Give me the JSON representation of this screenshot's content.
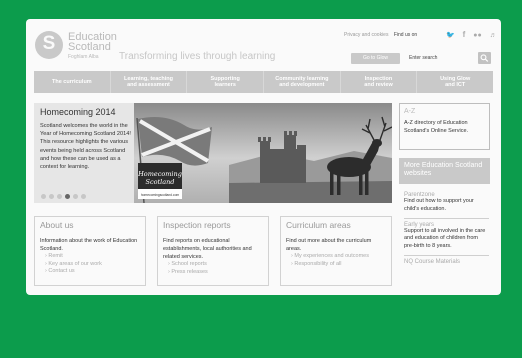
{
  "header": {
    "brand_line1": "Education",
    "brand_line2": "Scotland",
    "brand_gaelic": "Foghlam Alba",
    "logo_letter": "S",
    "tagline": "Transforming lives through learning",
    "top_links": [
      "Privacy and cookies",
      "Find us on"
    ],
    "social_icons": [
      "twitter-icon",
      "facebook-icon",
      "flickr-icon",
      "podcast-icon"
    ],
    "glow_label": "Go to Glow",
    "search_placeholder": "Enter search"
  },
  "nav": {
    "items": [
      {
        "label": "The curriculum"
      },
      {
        "label": "Learning, teaching\nand assessment"
      },
      {
        "label": "Supporting\nlearners"
      },
      {
        "label": "Community learning\nand development"
      },
      {
        "label": "Inspection\nand review"
      },
      {
        "label": "Using Glow\nand ICT"
      }
    ]
  },
  "feature": {
    "title": "Homecoming 2014",
    "text": "Scotland welcomes the world in the Year of Homecoming Scotland 2014! This resource highlights the various events being held across Scotland and how these can be used as a context for learning.",
    "sign_line1": "Homecoming",
    "sign_line2": "Scotland",
    "sign_url": "homecomingscotland.com",
    "slides": 6,
    "active_slide": 3
  },
  "sidebar": {
    "az_title": "A-Z",
    "az_desc": "A-Z directory of Education Scotland's Online Service.",
    "more_title": "More Education Scotland websites",
    "links": [
      {
        "title": "Parentzone",
        "desc": "Find out how to support your child's education."
      },
      {
        "title": "Early years",
        "desc": "Support to all involved in the care and education of children from pre-birth to 8 years."
      },
      {
        "title": "NQ Course Materials",
        "desc": ""
      }
    ]
  },
  "boxes": [
    {
      "title": "About us",
      "text": "Information about the work of Education Scotland.",
      "links": [
        "Remit",
        "Key areas of our work",
        "Contact us"
      ]
    },
    {
      "title": "Inspection reports",
      "text": "Find reports on educational establishments, local authorities and related services.",
      "links": [
        "School reports",
        "Press releases"
      ]
    },
    {
      "title": "Curriculum areas",
      "text": "Find out more about the curriculum areas.",
      "links": [
        "My experiences and outcomes",
        "Responsibility of all"
      ]
    }
  ],
  "colors": {
    "background": "#0c9c4c",
    "page": "#fafafa",
    "nav": "#c9c9c9",
    "feature": "#e6e6e6"
  }
}
